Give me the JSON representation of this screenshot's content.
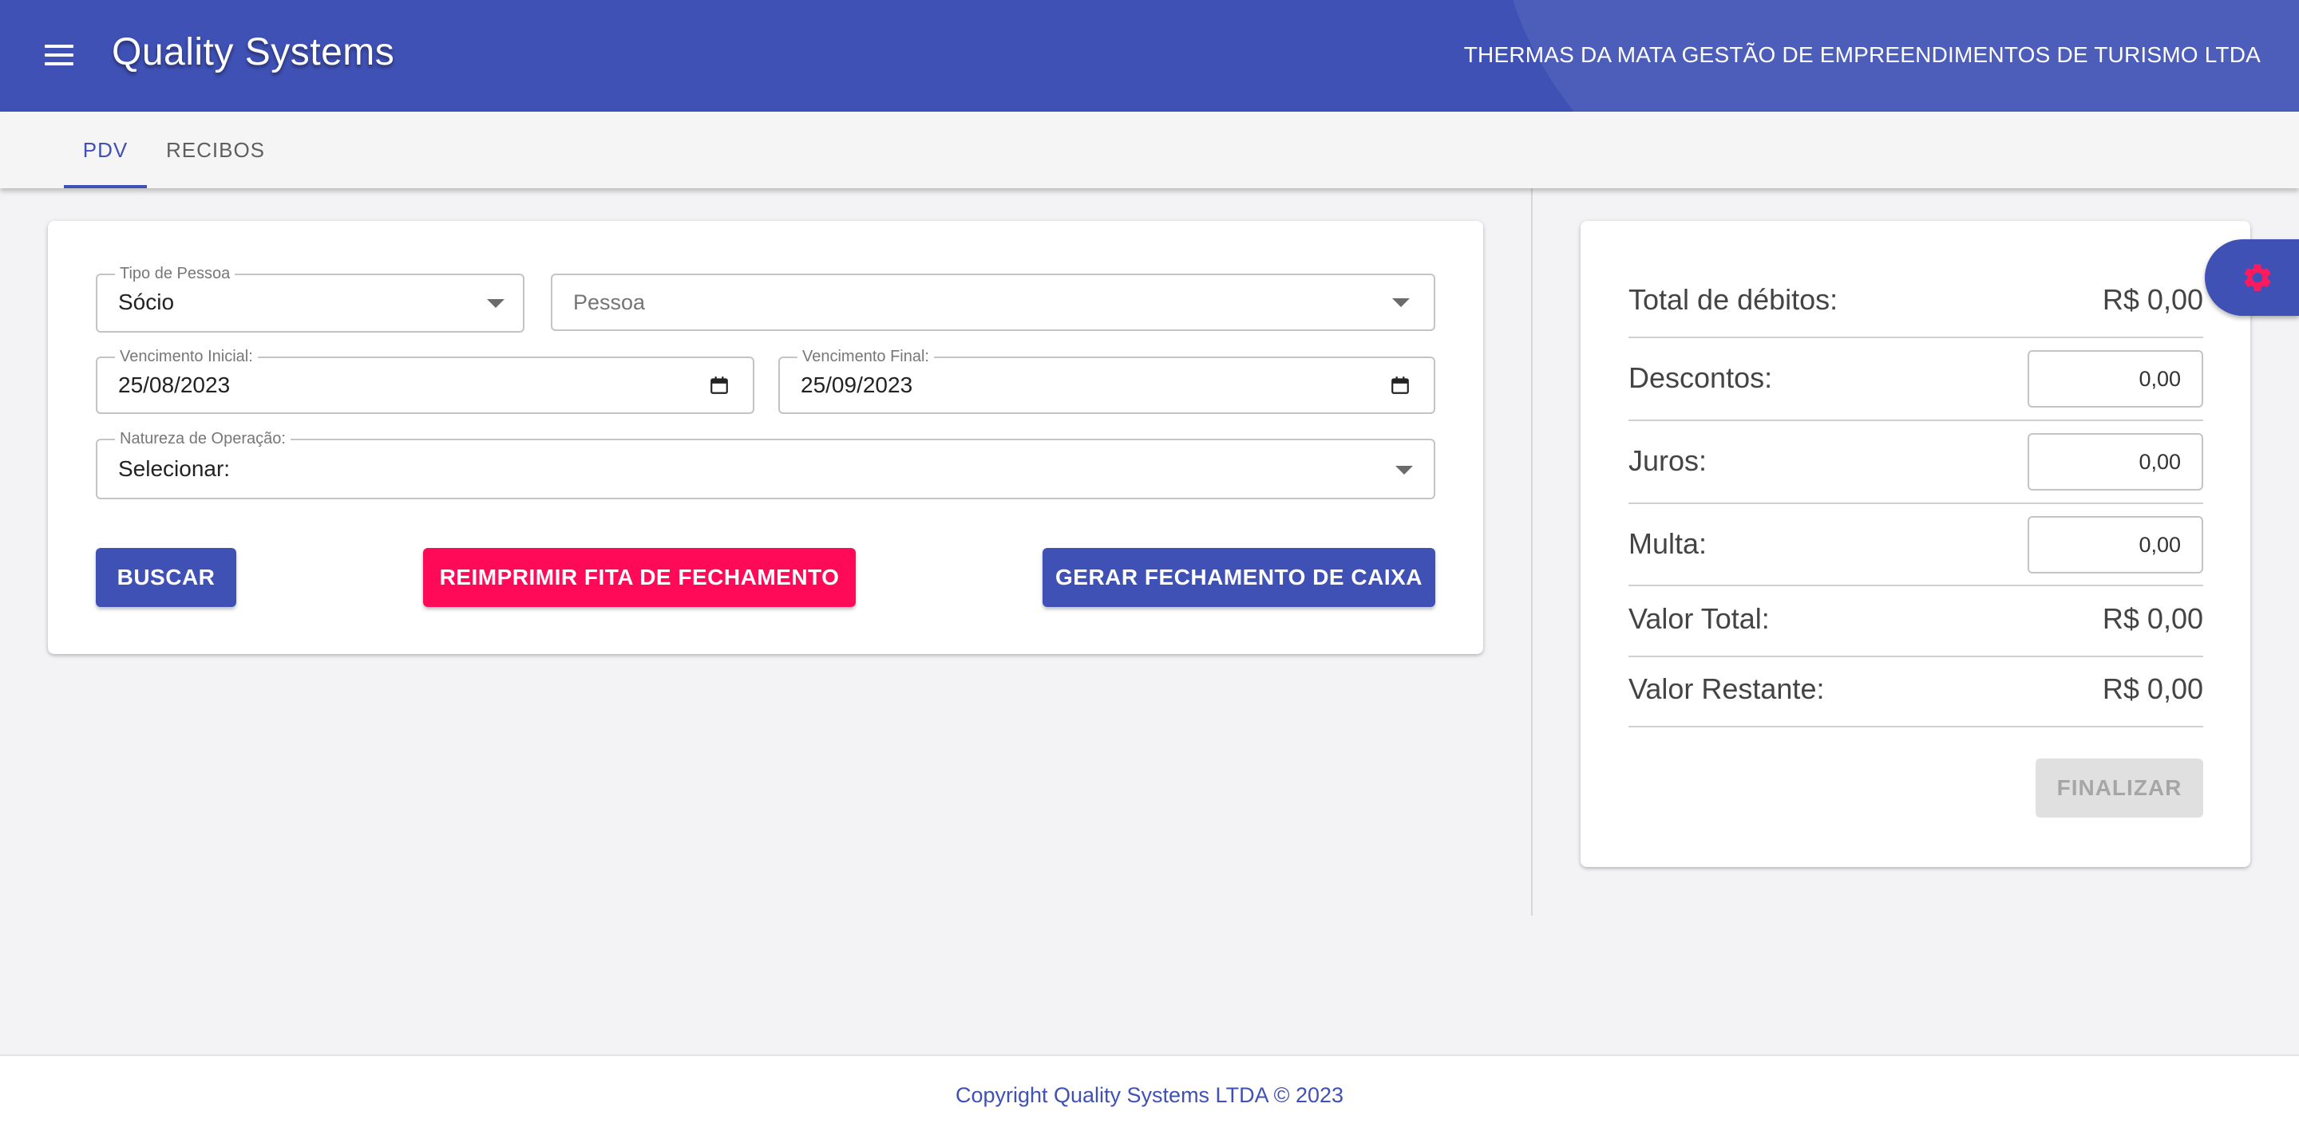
{
  "header": {
    "title": "Quality Systems",
    "company": "THERMAS DA MATA GESTÃO DE EMPREENDIMENTOS DE TURISMO LTDA",
    "menu_icon": "menu-icon",
    "brand_color": "#3f51b5"
  },
  "tabs": [
    {
      "label": "PDV",
      "active": true
    },
    {
      "label": "RECIBOS",
      "active": false
    }
  ],
  "filters": {
    "tipo_pessoa": {
      "label": "Tipo de Pessoa",
      "value": "Sócio"
    },
    "pessoa": {
      "placeholder": "Pessoa"
    },
    "vencimento_inicial": {
      "label": "Vencimento Inicial:",
      "value": "25/08/2023"
    },
    "vencimento_final": {
      "label": "Vencimento Final:",
      "value": "25/09/2023"
    },
    "natureza_operacao": {
      "label": "Natureza de Operação:",
      "value": "Selecionar:"
    }
  },
  "actions": {
    "buscar": "BUSCAR",
    "reimprimir": "REIMPRIMIR FITA DE FECHAMENTO",
    "gerar_fechamento": "GERAR FECHAMENTO DE CAIXA",
    "accent_color": "#ff0a58"
  },
  "summary": {
    "total_debitos": {
      "label": "Total de débitos:",
      "value": "R$ 0,00"
    },
    "descontos": {
      "label": "Descontos:",
      "value": "0,00"
    },
    "juros": {
      "label": "Juros:",
      "value": "0,00"
    },
    "multa": {
      "label": "Multa:",
      "value": "0,00"
    },
    "valor_total": {
      "label": "Valor Total:",
      "value": "R$ 0,00"
    },
    "valor_restante": {
      "label": "Valor Restante:",
      "value": "R$ 0,00"
    },
    "finalizar": "FINALIZAR"
  },
  "settings_icon": "gear-icon",
  "footer": {
    "copyright": "Copyright Quality Systems LTDA © 2023"
  }
}
